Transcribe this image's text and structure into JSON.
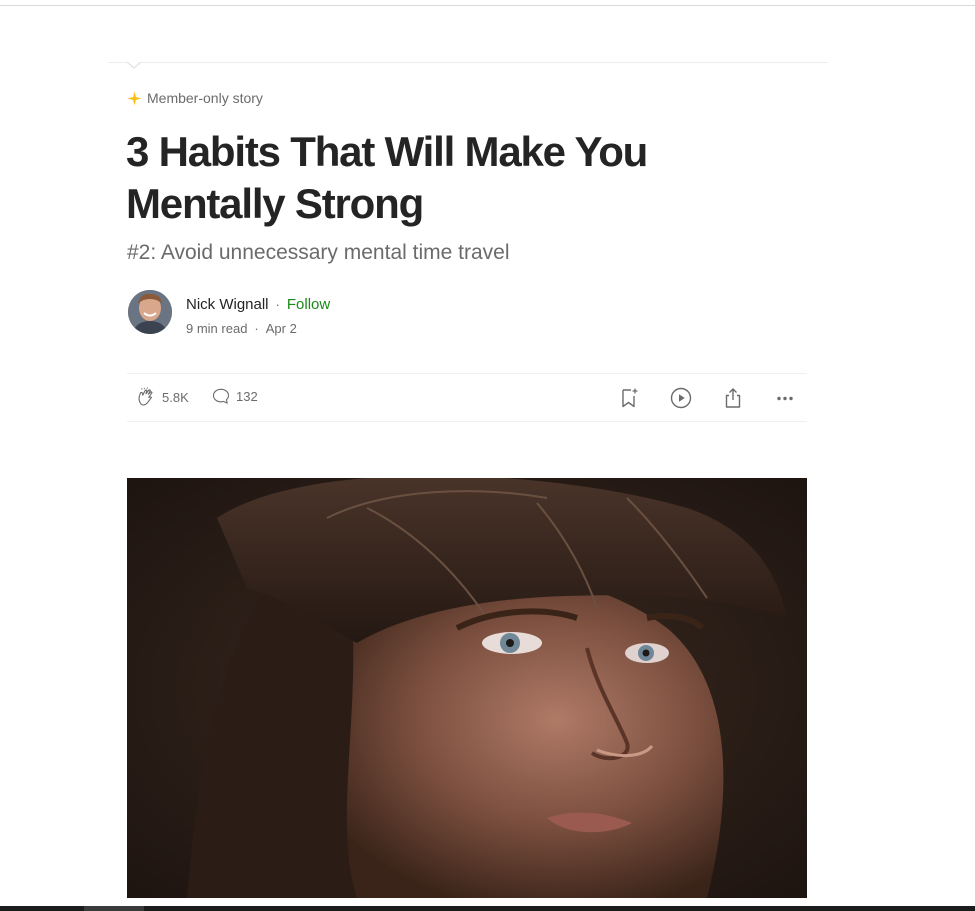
{
  "badge": {
    "icon": "star-icon",
    "label": "Member-only story",
    "color": "#ffc017"
  },
  "article": {
    "title": "3 Habits That Will Make You Mentally Strong",
    "subtitle": "#2: Avoid unnecessary mental time travel"
  },
  "author": {
    "name": "Nick Wignall",
    "separator": "·",
    "follow_label": "Follow",
    "read_time": "9 min read",
    "date": "Apr 2"
  },
  "actions": {
    "claps": "5.8K",
    "responses": "132",
    "icons": [
      "clap-icon",
      "comment-icon",
      "bookmark-icon",
      "listen-icon",
      "share-icon",
      "more-icon"
    ]
  },
  "hero_image": {
    "description_icon": "portrait-photo"
  },
  "colors": {
    "text": "#242424",
    "muted": "#6b6b6b",
    "follow": "#1a8917",
    "accent": "#ffc017"
  }
}
